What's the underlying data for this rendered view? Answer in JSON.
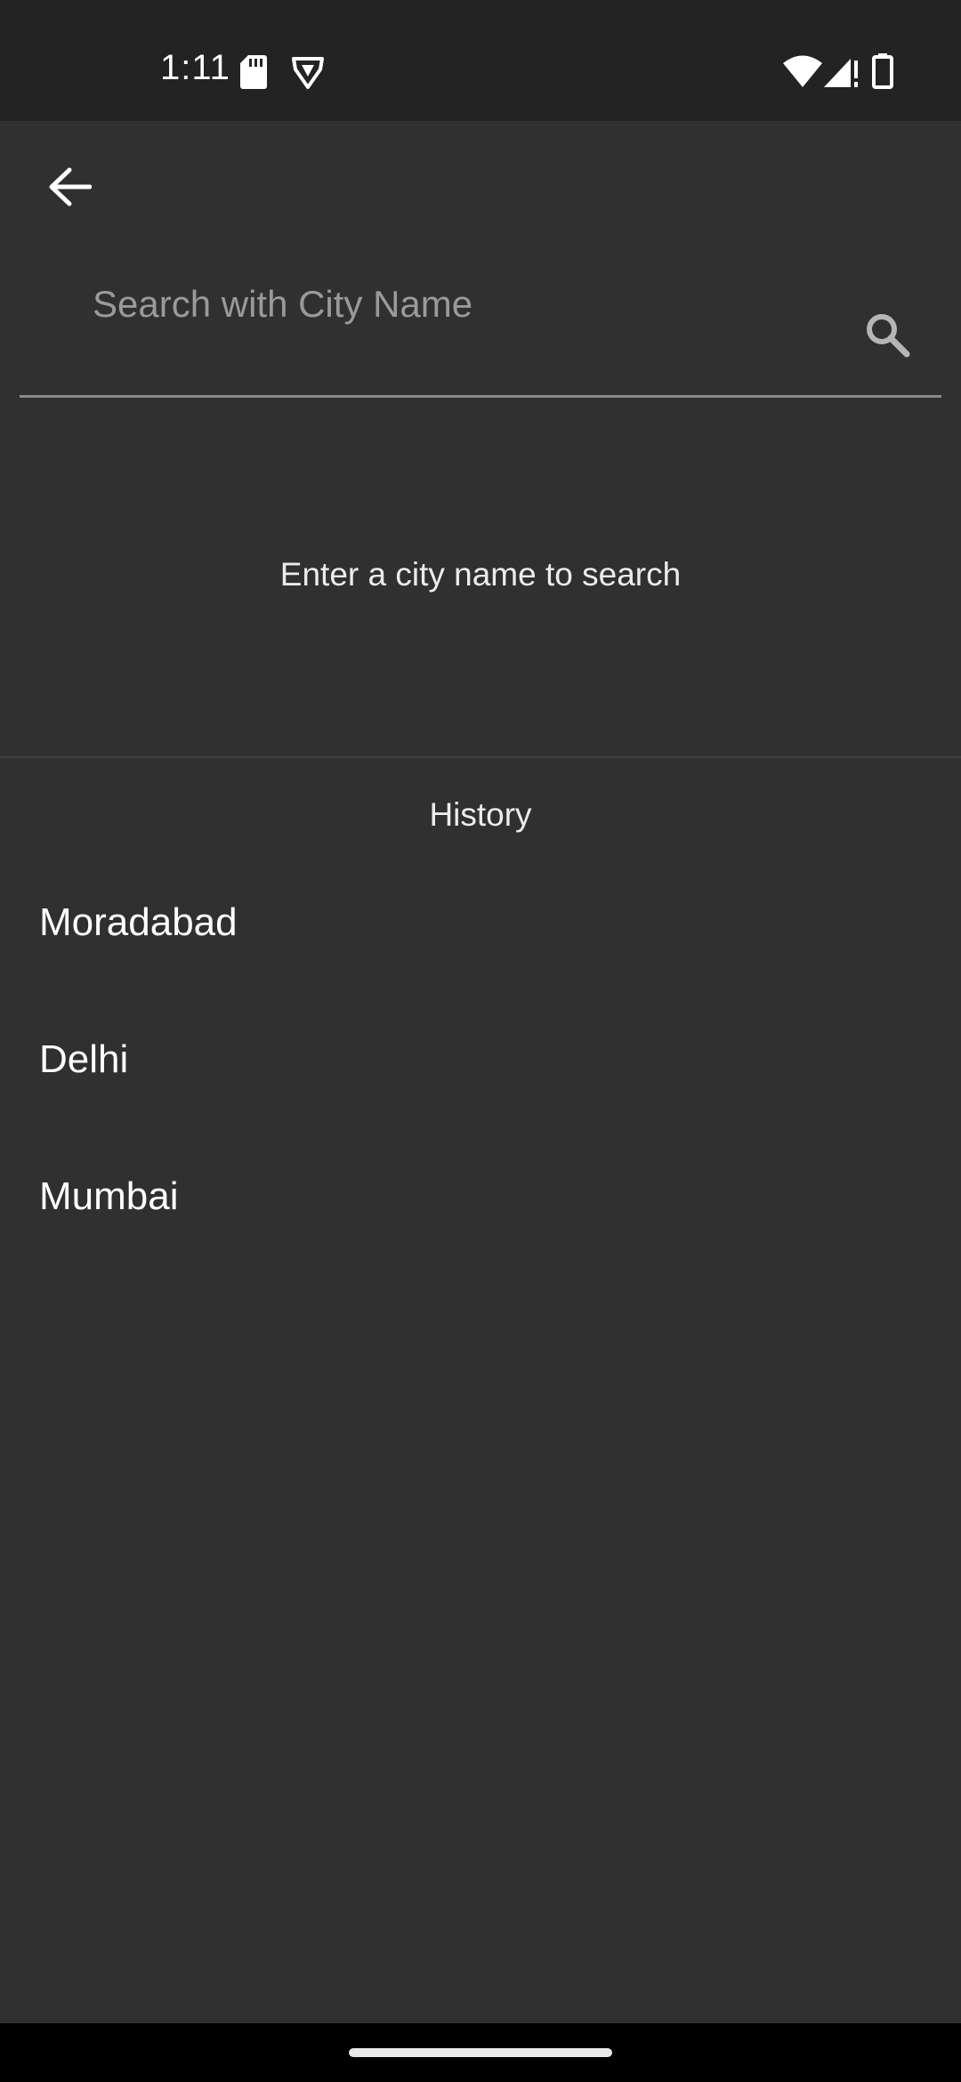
{
  "status_bar": {
    "time": "1:11",
    "icons": [
      "sd-card-icon",
      "vpn-shield-icon",
      "wifi-icon",
      "signal-icon",
      "battery-icon"
    ]
  },
  "search": {
    "placeholder": "Search with City Name",
    "value": ""
  },
  "hint": "Enter a city name to search",
  "history": {
    "heading": "History",
    "items": [
      "Moradabad",
      "Delhi",
      "Mumbai"
    ]
  },
  "colors": {
    "background": "#303030",
    "status_bar": "#232323",
    "text": "#ffffff",
    "placeholder": "#9a9a9a",
    "underline": "#8a8a8a"
  }
}
